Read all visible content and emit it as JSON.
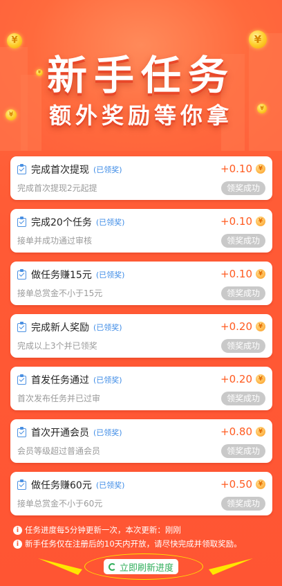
{
  "banner": {
    "title": "新手任务",
    "subtitle": "额外奖励等你拿"
  },
  "tasks": [
    {
      "title": "完成首次提现",
      "status": "(已领奖)",
      "desc": "完成首次提现2元起提",
      "reward": "+0.10",
      "button": "领奖成功"
    },
    {
      "title": "完成20个任务",
      "status": "(已领奖)",
      "desc": "接单并成功通过审核",
      "reward": "+0.10",
      "button": "领奖成功"
    },
    {
      "title": "做任务赚15元",
      "status": "(已领奖)",
      "desc": "接单总赏金不小于15元",
      "reward": "+0.10",
      "button": "领奖成功"
    },
    {
      "title": "完成新人奖励",
      "status": "(已领奖)",
      "desc": "完成以上3个并已领奖",
      "reward": "+0.20",
      "button": "领奖成功"
    },
    {
      "title": "首发任务通过",
      "status": "(已领奖)",
      "desc": "首次发布任务并已过审",
      "reward": "+0.20",
      "button": "领奖成功"
    },
    {
      "title": "首次开通会员",
      "status": "(已领奖)",
      "desc": "会员等级超过普通会员",
      "reward": "+0.80",
      "button": "领奖成功"
    },
    {
      "title": "做任务赚60元",
      "status": "(已领奖)",
      "desc": "接单总赏金不小于60元",
      "reward": "+0.50",
      "button": "领奖成功"
    }
  ],
  "notes": [
    "任务进度每5分钟更新一次，本次更新：刚刚",
    "新手任务仅在注册后的10天内开放，请尽快完成并领取奖励。"
  ],
  "refresh_label": "立即刷新进度",
  "colors": {
    "background": "#ff5a35",
    "accent": "#ff5a1f",
    "claimed": "#3d8be6",
    "refresh": "#2fae5a",
    "highlight": "#ffe600"
  }
}
